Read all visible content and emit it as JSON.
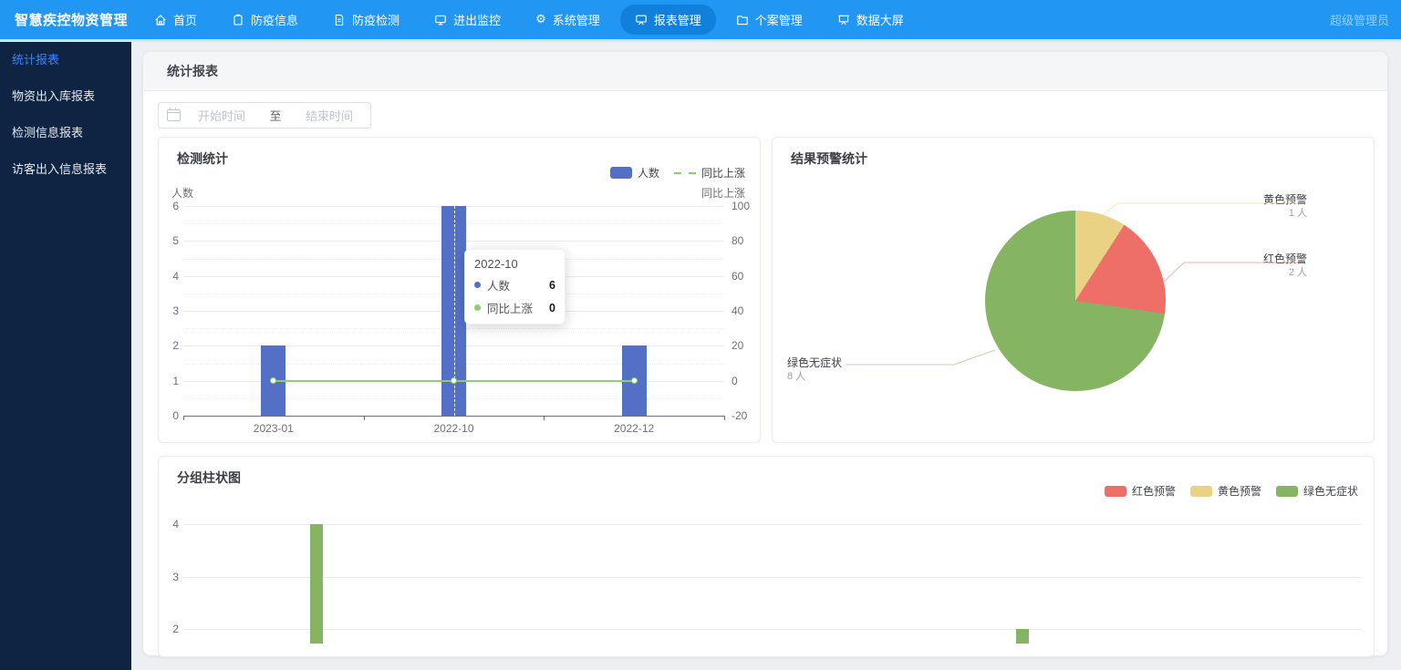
{
  "topbar": {
    "brand": "智慧疾控物资管理",
    "user": "超级管理员",
    "items": [
      {
        "label": "首页",
        "icon": "home-icon",
        "active": false
      },
      {
        "label": "防疫信息",
        "icon": "clipboard-icon",
        "active": false
      },
      {
        "label": "防疫检测",
        "icon": "file-icon",
        "active": false
      },
      {
        "label": "进出监控",
        "icon": "monitor-icon",
        "active": false
      },
      {
        "label": "系统管理",
        "icon": "gear-icon",
        "active": false
      },
      {
        "label": "报表管理",
        "icon": "board-icon",
        "active": true
      },
      {
        "label": "个案管理",
        "icon": "folder-icon",
        "active": false
      },
      {
        "label": "数据大屏",
        "icon": "screen-icon",
        "active": false
      }
    ]
  },
  "sidebar": {
    "items": [
      {
        "label": "统计报表",
        "active": true
      },
      {
        "label": "物资出入库报表",
        "active": false
      },
      {
        "label": "检测信息报表",
        "active": false
      },
      {
        "label": "访客出入信息报表",
        "active": false
      }
    ]
  },
  "main": {
    "header_title": "统计报表",
    "date_filter": {
      "start_placeholder": "开始时间",
      "separator": "至",
      "end_placeholder": "结束时间"
    }
  },
  "chart_data": [
    {
      "type": "bar",
      "title": "检测统计",
      "categories": [
        "2023-01",
        "2022-10",
        "2022-12"
      ],
      "series": [
        {
          "name": "人数",
          "type": "bar",
          "axis": "left",
          "color": "#5470c6",
          "values": [
            2,
            6,
            2
          ]
        },
        {
          "name": "同比上涨",
          "type": "line",
          "axis": "right",
          "color": "#91cc75",
          "values": [
            0,
            0,
            0
          ]
        }
      ],
      "y_left": {
        "name": "人数",
        "min": 0,
        "max": 6,
        "step": 1
      },
      "y_right": {
        "name": "同比上涨",
        "min": -20,
        "max": 100,
        "step": 20
      },
      "legend": [
        "人数",
        "同比上涨"
      ],
      "grid": true,
      "legend_position": "top-right",
      "tooltip": {
        "title": "2022-10",
        "pointer_category_index": 1,
        "rows": [
          {
            "name": "人数",
            "value": "6",
            "color": "#5470c6"
          },
          {
            "name": "同比上涨",
            "value": "0",
            "color": "#91cc75"
          }
        ]
      }
    },
    {
      "type": "pie",
      "title": "结果预警统计",
      "unit": "人",
      "slices": [
        {
          "label": "黄色预警",
          "value": 1,
          "color": "#e9d284"
        },
        {
          "label": "红色预警",
          "value": 2,
          "color": "#ee6f68"
        },
        {
          "label": "绿色无症状",
          "value": 8,
          "color": "#85b562"
        }
      ]
    },
    {
      "type": "bar",
      "title": "分组柱状图",
      "legend": [
        {
          "name": "红色预警",
          "color": "#ee6f68"
        },
        {
          "name": "黄色预警",
          "color": "#e9d284"
        },
        {
          "name": "绿色无症状",
          "color": "#85b562"
        }
      ],
      "legend_position": "top-right",
      "y_ticks": [
        4,
        3,
        2
      ],
      "grid": true,
      "visible_bars": [
        {
          "series": "绿色无症状",
          "value": 4,
          "x_frac": 0.113
        },
        {
          "series": "绿色无症状",
          "value": 2,
          "x_frac": 0.712
        }
      ]
    }
  ],
  "colors": {
    "topbar_bg": "#2296f3",
    "topbar_active_bg": "#1180dd",
    "sidebar_bg": "#0e2442",
    "sidebar_active_text": "#3d84f7",
    "page_bg": "#edeff3",
    "bar_blue": "#5470c6",
    "line_green": "#91cc75",
    "warn_red": "#ee6f68",
    "warn_yellow": "#e9d284",
    "ok_green": "#85b562",
    "axis_text": "#6e7079",
    "grid_line": "#e8ebf2"
  }
}
